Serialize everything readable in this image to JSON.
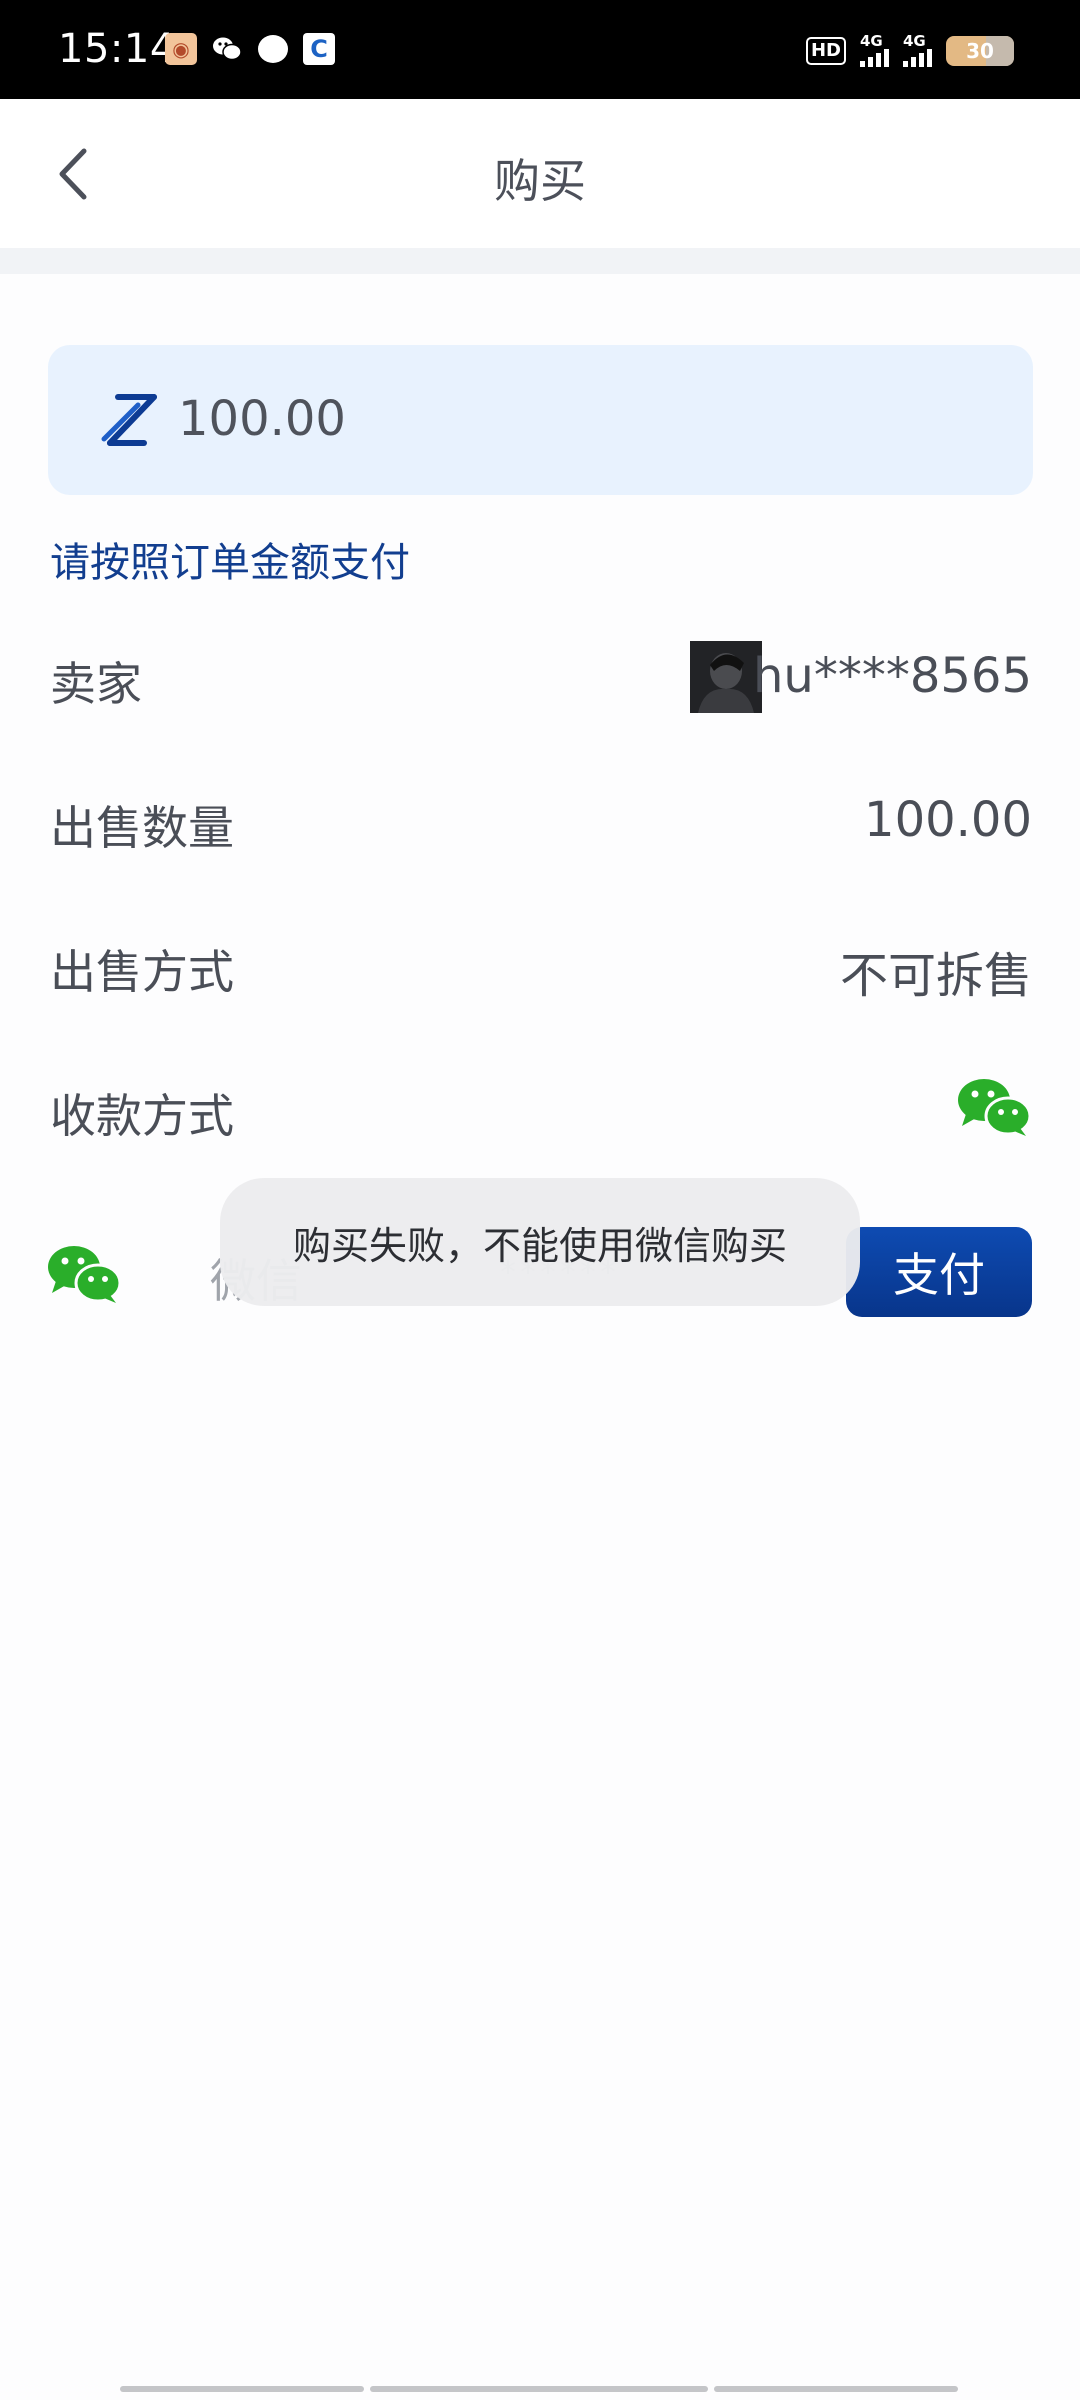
{
  "status_bar": {
    "time": "15:14",
    "hd_label": "HD",
    "network_1": "4G",
    "network_2": "4G",
    "battery": "30"
  },
  "header": {
    "title": "购买"
  },
  "order": {
    "amount": "100.00",
    "hint": "请按照订单金额支付"
  },
  "details": {
    "seller_label": "卖家",
    "seller_name": "hu****8565",
    "quantity_label": "出售数量",
    "quantity_value": "100.00",
    "sale_mode_label": "出售方式",
    "sale_mode_value": "不可拆售",
    "payment_label": "收款方式"
  },
  "payment": {
    "method": "微信",
    "account": "******",
    "pay_button": "支付"
  },
  "toast": {
    "message": "购买失败，不能使用微信购买"
  },
  "colors": {
    "accent": "#0e4bb2",
    "hint_blue": "#123e8f",
    "card_bg": "#e8f2fe",
    "wechat_green": "#2aae2a"
  },
  "icons": {
    "back": "chevron-left-icon",
    "amount": "z-coin-icon",
    "payment": "wechat-icon"
  }
}
